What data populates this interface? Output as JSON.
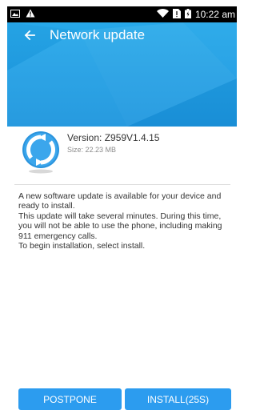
{
  "status_bar": {
    "time": "10:22 am"
  },
  "header": {
    "title": "Network update"
  },
  "update": {
    "version": "Version: Z959V1.4.15",
    "size": "Size: 22.23 MB"
  },
  "description": {
    "line1": "A new software update is available for your device and ready to install.",
    "line2": "This update will take several minutes. During this time, you will not be able to use the phone, including making 911 emergency calls.",
    "line3": "To begin installation, select install."
  },
  "buttons": {
    "postpone": "POSTPONE",
    "install": "INSTALL(25S)"
  },
  "colors": {
    "accent": "#2c9cef",
    "header": "#1f9ce3"
  }
}
